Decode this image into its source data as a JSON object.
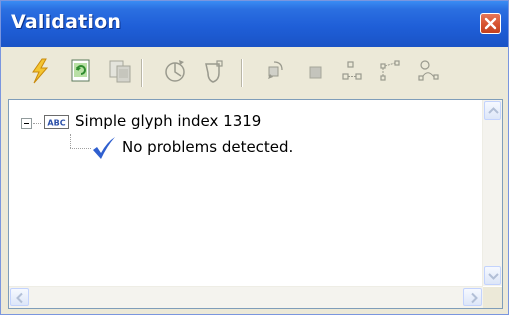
{
  "window": {
    "title": "Validation"
  },
  "toolbar": {
    "buttons": [
      {
        "name": "validate-icon"
      },
      {
        "name": "refresh-icon"
      },
      {
        "name": "copy-icon"
      },
      {
        "name": "target-icon"
      },
      {
        "name": "shield-icon"
      },
      {
        "name": "rotate-icon"
      },
      {
        "name": "square-icon"
      },
      {
        "name": "distribute-icon"
      },
      {
        "name": "curve-points-icon"
      },
      {
        "name": "path-icon"
      }
    ]
  },
  "tree": {
    "items": [
      {
        "label": "Simple glyph index 1319",
        "icon": "abc-icon",
        "expanded": true
      },
      {
        "label": "No problems detected.",
        "icon": "checkmark-icon"
      }
    ]
  },
  "colors": {
    "titlebar": "#2b6fe1",
    "close_button": "#d6522f",
    "check": "#2f5fcf",
    "window_bg": "#ece9d8"
  }
}
